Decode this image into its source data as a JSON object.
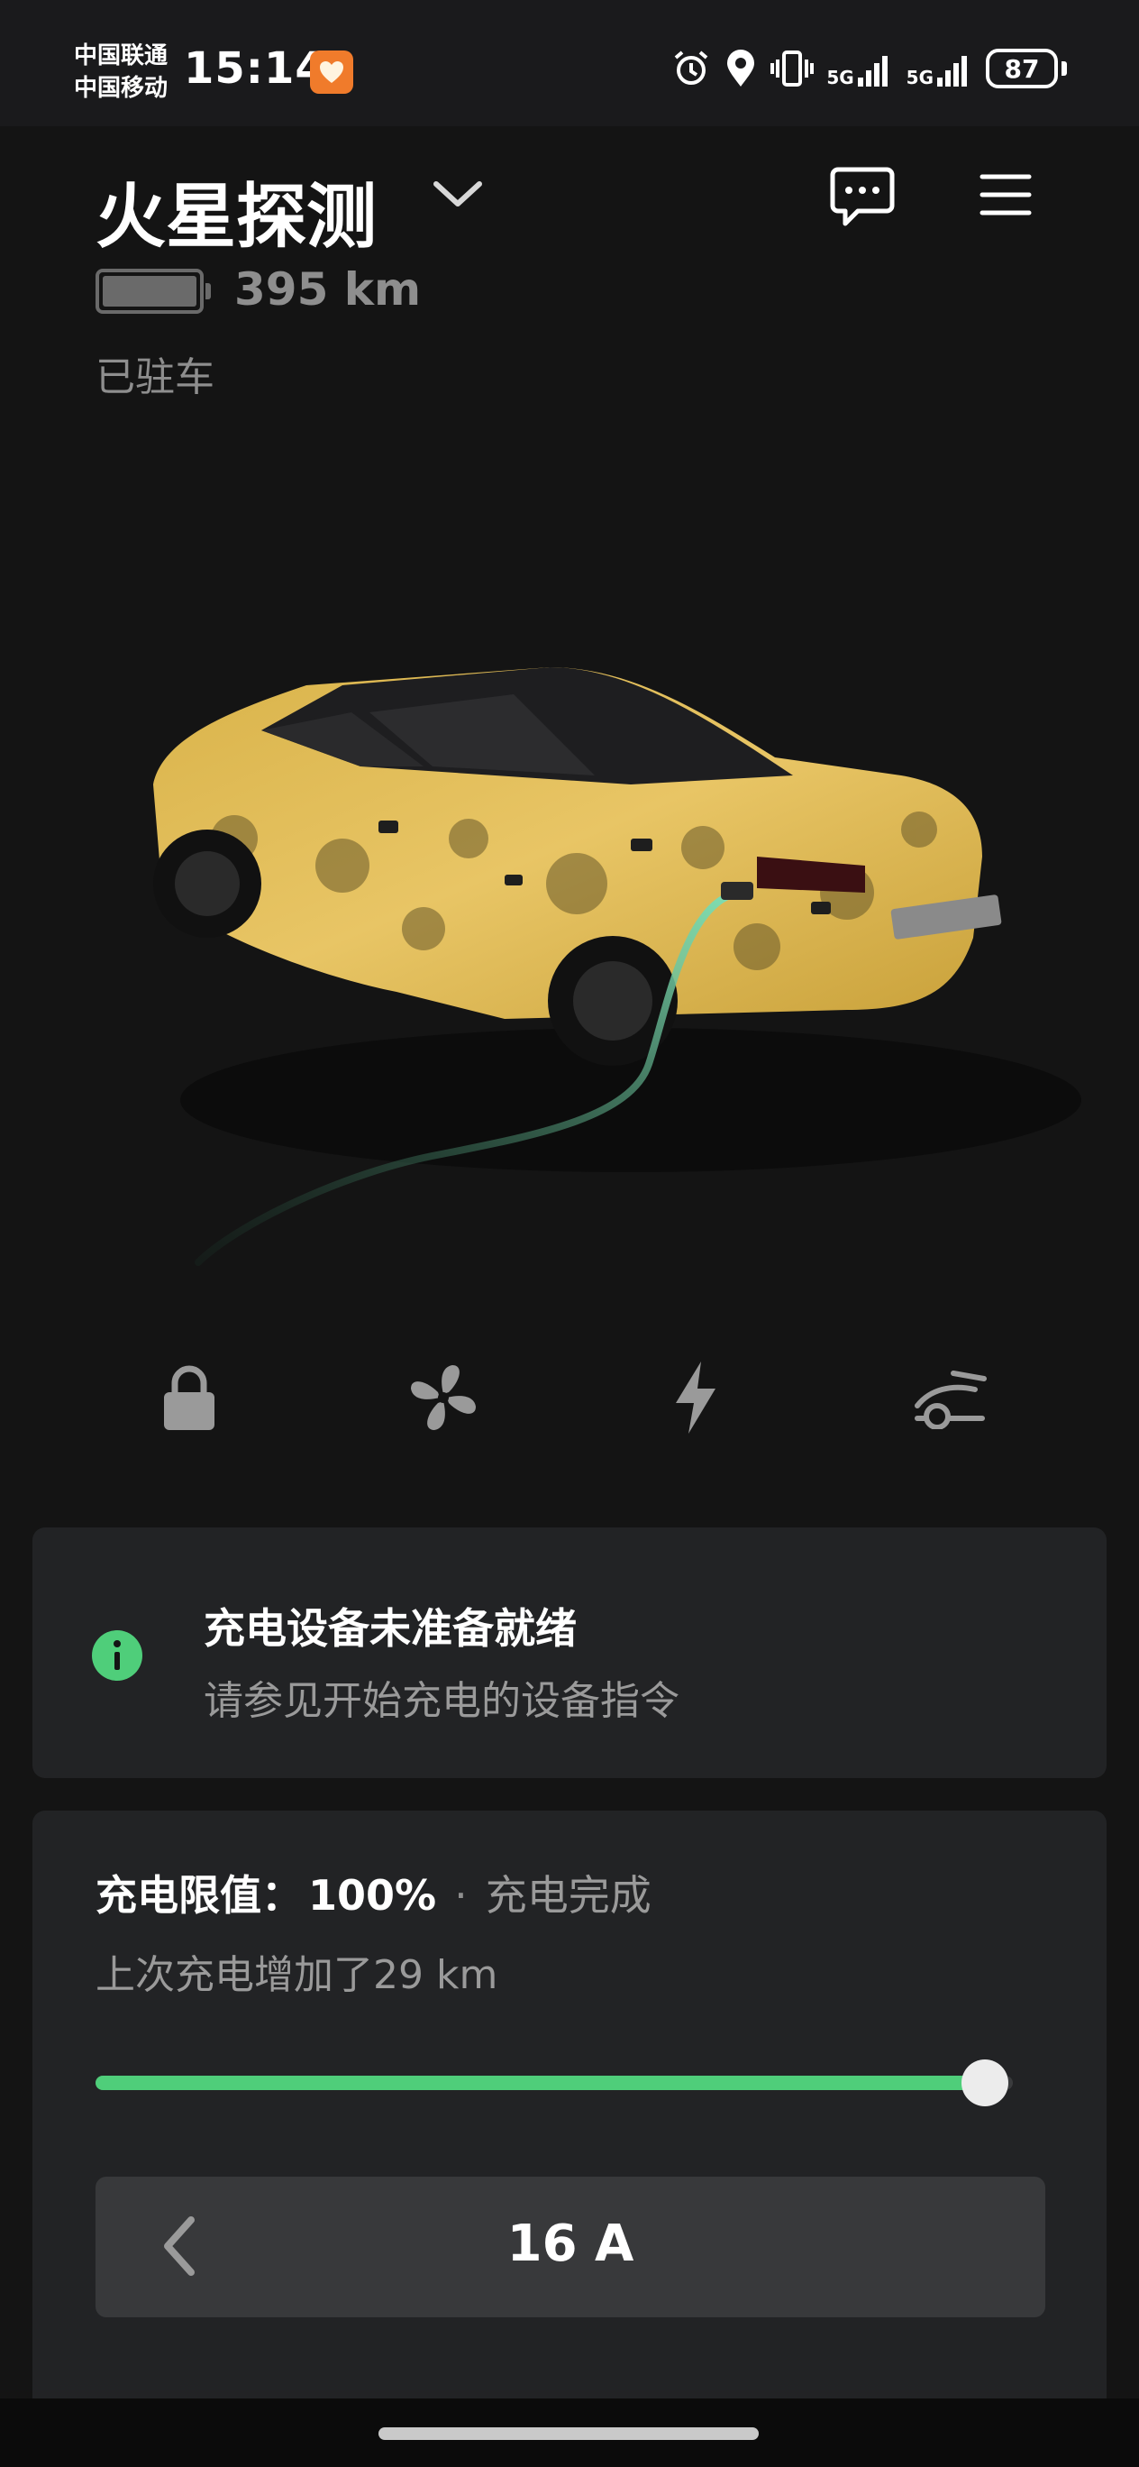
{
  "status_bar": {
    "carrier_1": "中国联通",
    "carrier_2": "中国移动",
    "time": "15:14",
    "network_1": "5G",
    "network_2": "5G",
    "battery_level": "87",
    "icons": [
      "app-badge-icon",
      "alarm-icon",
      "location-icon",
      "vibrate-icon",
      "signal-icon",
      "signal-icon",
      "battery-icon"
    ]
  },
  "header": {
    "vehicle_name": "火星探测",
    "range": "395 km",
    "state": "已驻车",
    "icons": [
      "chevron-down-icon",
      "message-icon",
      "menu-icon"
    ]
  },
  "quick_controls": [
    {
      "icon": "lock-icon"
    },
    {
      "icon": "fan-icon"
    },
    {
      "icon": "lightning-icon"
    },
    {
      "icon": "trunk-icon"
    }
  ],
  "alert": {
    "title": "充电设备未准备就绪",
    "subtitle": "请参见开始充电的设备指令",
    "icon": "info-icon",
    "icon_color": "#4fce7a"
  },
  "charging": {
    "limit_label": "充电限值：",
    "limit_value": "100%",
    "separator": "·",
    "status": "充电完成",
    "added": "上次充电增加了29 km",
    "slider_fraction": 0.97,
    "slider_color": "#4fce7a",
    "current": "16 A"
  }
}
